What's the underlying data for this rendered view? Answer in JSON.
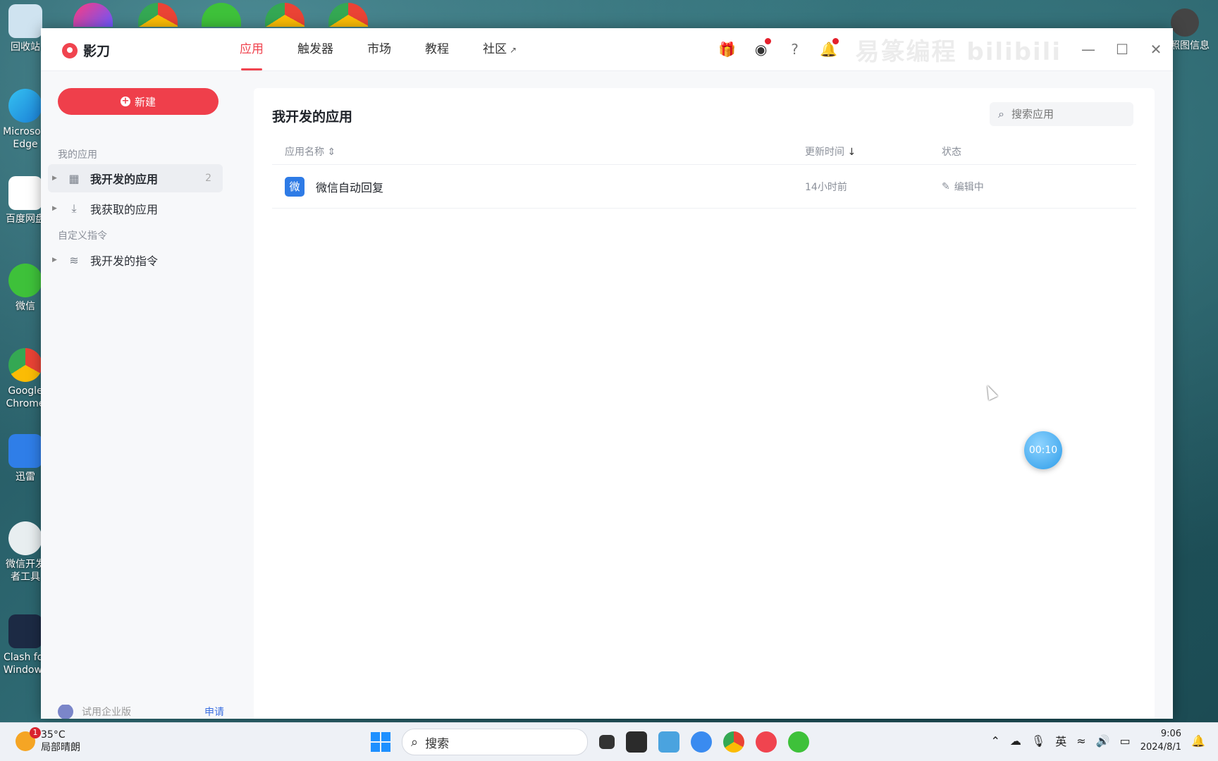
{
  "desktop": {
    "icons": [
      {
        "label": "回收站"
      },
      {
        "label": "Microsoft Edge"
      },
      {
        "label": "百度网盘"
      },
      {
        "label": "微信"
      },
      {
        "label": "Google Chrome"
      },
      {
        "label": "迅雷"
      },
      {
        "label": "微信开发者工具"
      },
      {
        "label": "Clash for Windows"
      }
    ],
    "right_icon_label": "快照图信息"
  },
  "window": {
    "brand": "影刀",
    "nav": [
      {
        "label": "应用"
      },
      {
        "label": "触发器"
      },
      {
        "label": "市场"
      },
      {
        "label": "教程"
      },
      {
        "label": "社区"
      }
    ],
    "watermark": "易篆编程 bilibili"
  },
  "sidebar": {
    "new_label": "新建",
    "section_my_apps": "我的应用",
    "items": [
      {
        "label": "我开发的应用",
        "count": "2"
      },
      {
        "label": "我获取的应用"
      }
    ],
    "section_custom": "自定义指令",
    "custom_items": [
      {
        "label": "我开发的指令"
      }
    ],
    "enterprise": {
      "label": "试用企业版",
      "link": "申请"
    }
  },
  "main": {
    "title": "我开发的应用",
    "search_placeholder": "搜索应用",
    "columns": {
      "name": "应用名称",
      "updated": "更新时间",
      "status": "状态"
    },
    "rows": [
      {
        "icon_text": "微",
        "name": "微信自动回复",
        "updated": "14小时前",
        "status": "编辑中"
      }
    ]
  },
  "timer": "00:10",
  "taskbar": {
    "weather_temp": "35°C",
    "weather_desc": "局部晴朗",
    "weather_badge": "1",
    "search_label": "搜索",
    "ime": "英",
    "time": "9:06",
    "date": "2024/8/1"
  },
  "colors": {
    "accent": "#ef3f4b",
    "link": "#3b6fe0",
    "app_icon": "#2e7be6"
  }
}
